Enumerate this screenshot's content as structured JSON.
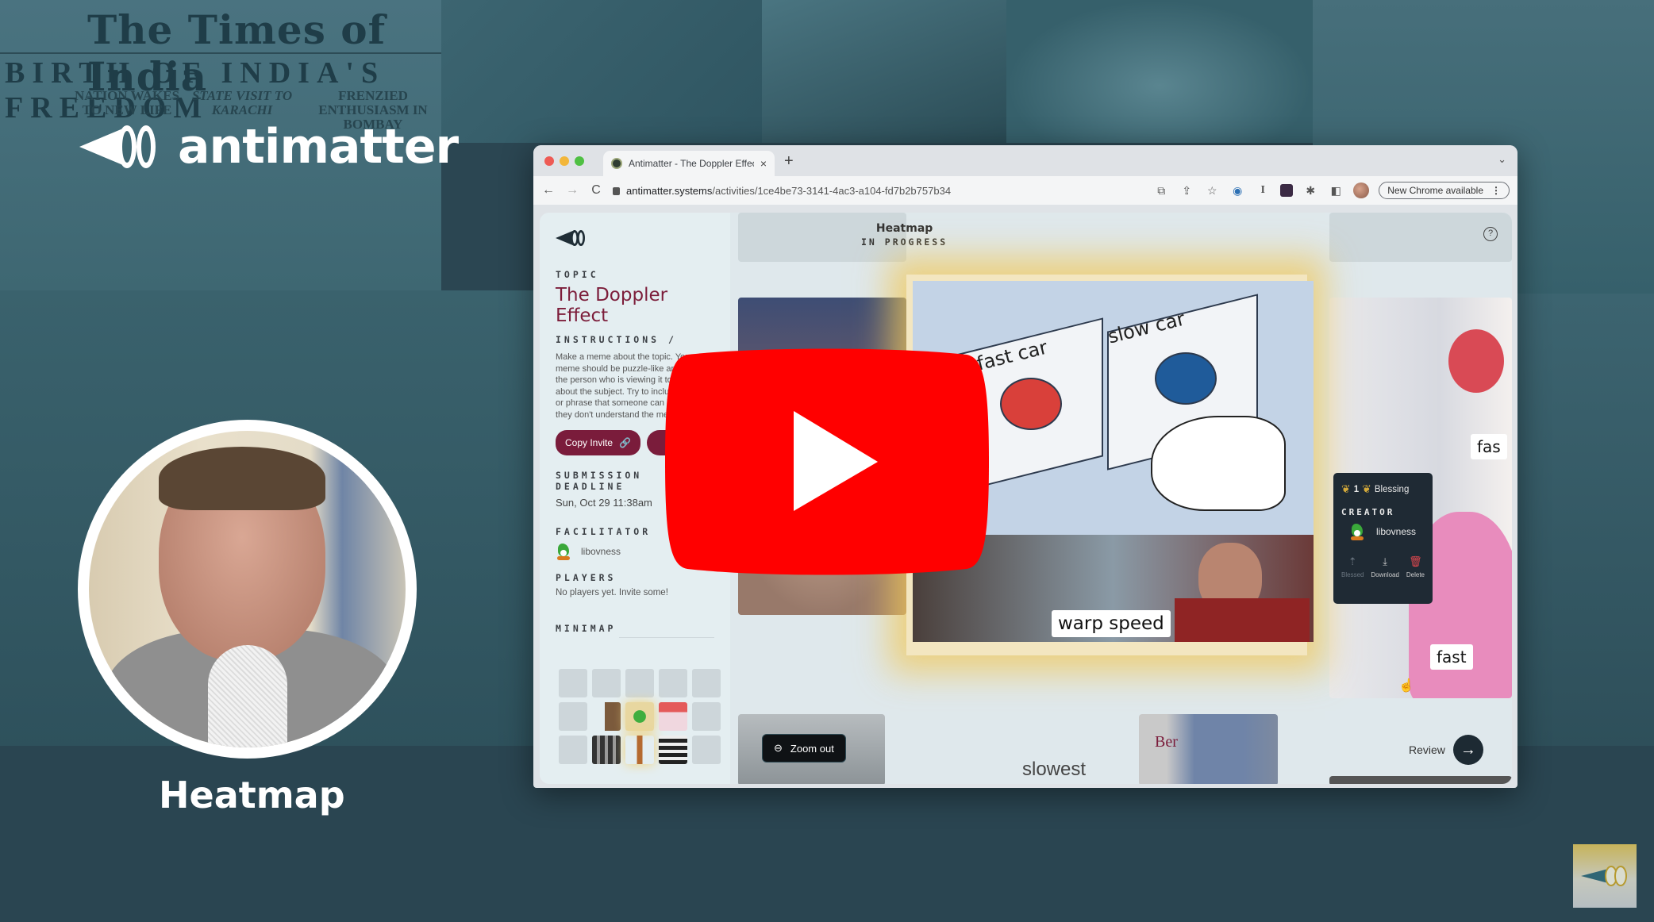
{
  "brand": {
    "name": "antimatter"
  },
  "background": {
    "newspaper": {
      "masthead": "The Times of India",
      "headline": "BIRTH OF INDIA'S FREEDOM",
      "columns": [
        "NATION WAKES TO NEW LIFE",
        "STATE VISIT TO KARACHI",
        "FRENZIED ENTHUSIASM IN BOMBAY"
      ]
    }
  },
  "presenter": {
    "caption": "Heatmap"
  },
  "browser": {
    "tab_title": "Antimatter - The Doppler Effect",
    "tab_close": "×",
    "new_tab": "+",
    "url_host": "antimatter.systems",
    "url_path": "/activities/1ce4be73-3141-4ac3-a104-fd7b2b757b34",
    "update_button": "New Chrome available",
    "menu_glyph": "⋮",
    "nav": {
      "back": "←",
      "forward": "→",
      "reload": "C"
    }
  },
  "app": {
    "topic_label": "TOPIC",
    "topic": "The Doppler Effect",
    "instructions_label": "INSTRUCTIONS",
    "instructions_text": "Make a meme about the topic. Your meme should be puzzle-like and require the person who is viewing it to think about the subject. Try to include a word or phrase that someone can look up if they don't understand the meme at first.",
    "copy_invite": "Copy Invite",
    "deadline_label": "SUBMISSION DEADLINE",
    "deadline": "Sun, Oct 29 11:38am",
    "facilitator_label": "FACILITATOR",
    "facilitator": "libovness",
    "players_label": "PLAYERS",
    "players_text": "No players yet. Invite some!",
    "minimap_label": "MINIMAP",
    "minimap": {
      "rows": 3,
      "cols": 5,
      "filled": [
        "r1c1",
        "r1c2",
        "r1c3",
        "r2c1",
        "r2c2",
        "r2c3"
      ]
    },
    "header": {
      "title": "Heatmap",
      "status": "IN PROGRESS"
    },
    "help": "?",
    "featured_meme": {
      "labels": [
        "fast car",
        "slow car"
      ],
      "caption": "warp speed"
    },
    "tile_captions": {
      "right_top": "fas",
      "right_bottom": "fast",
      "bottom_center": "slowest",
      "bottom_right_sign": "Ber"
    },
    "tooltip": {
      "blessing_count": "1",
      "blessing_label": "Blessing",
      "creator_label": "CREATOR",
      "creator": "libovness",
      "actions": [
        "Blessed",
        "Download",
        "Delete"
      ]
    },
    "zoom_out": "Zoom out",
    "review": "Review"
  },
  "overlay": {
    "player": "youtube-play-button"
  }
}
